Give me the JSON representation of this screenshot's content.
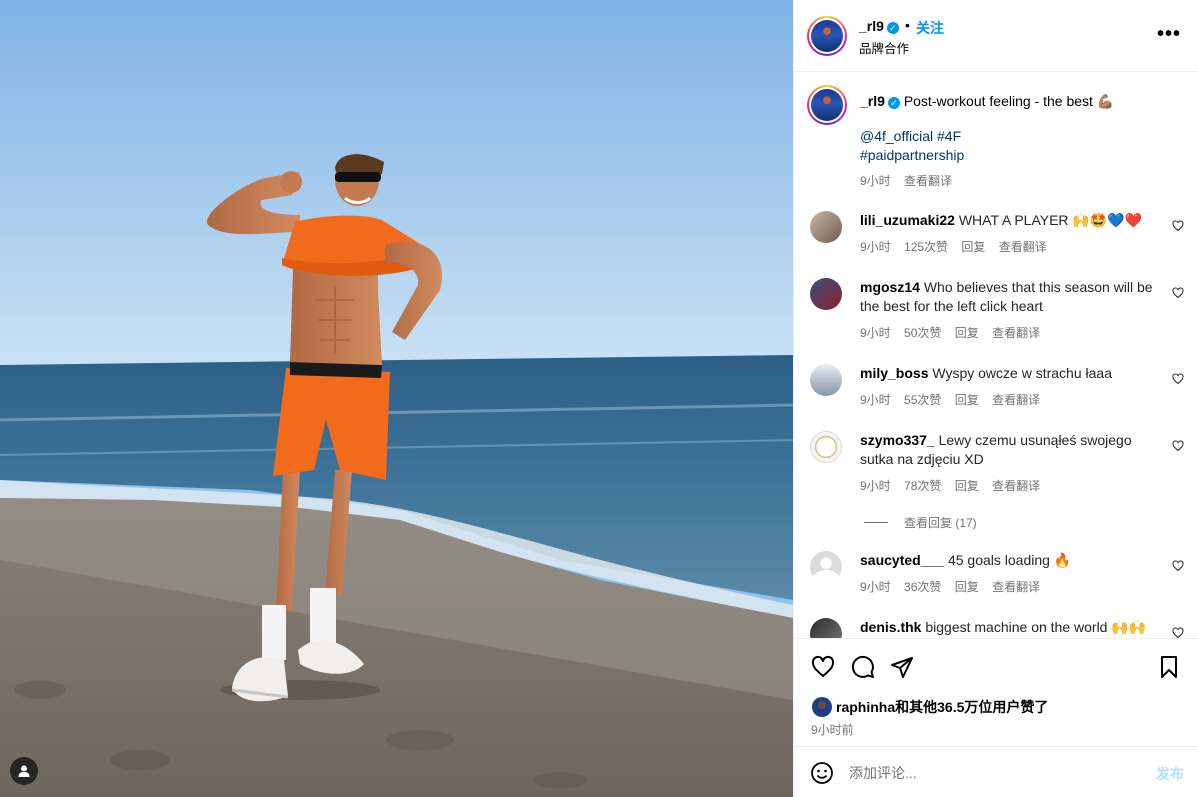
{
  "header": {
    "username": "_rl9",
    "verified_mark": "✓",
    "separator": "•",
    "follow_label": "关注",
    "subtitle": "品牌合作",
    "more_icon": "more-horizontal-icon"
  },
  "caption": {
    "username": "_rl9",
    "verified_mark": "✓",
    "text": "Post-workout feeling - the best 💪🏽",
    "mentions": "@4f_official #4F",
    "hashtags": "#paidpartnership",
    "time": "9小时",
    "translate": "查看翻译"
  },
  "comments": [
    {
      "username": "lili_uzumaki22",
      "text": "WHAT A PLAYER 🙌🤩💙❤️",
      "time": "9小时",
      "likes": "125次赞",
      "reply": "回复",
      "translate": "查看翻译"
    },
    {
      "username": "mgosz14",
      "text": "Who believes that this season will be the best for the left click heart",
      "time": "9小时",
      "likes": "50次赞",
      "reply": "回复",
      "translate": "查看翻译"
    },
    {
      "username": "mily_boss",
      "text": "Wyspy owcze w strachu łaaa",
      "time": "9小时",
      "likes": "55次赞",
      "reply": "回复",
      "translate": "查看翻译"
    },
    {
      "username": "szymo337_",
      "text": "Lewy czemu usunąłeś swojego sutka na zdjęciu XD",
      "time": "9小时",
      "likes": "78次赞",
      "reply": "回复",
      "translate": "查看翻译"
    },
    {
      "username": "saucyted___",
      "text": "45 goals loading 🔥",
      "time": "9小时",
      "likes": "36次赞",
      "reply": "回复",
      "translate": "查看翻译"
    },
    {
      "username": "denis.thk",
      "text": "biggest machine on the world 🙌🙌",
      "time": "",
      "likes": "",
      "reply": "",
      "translate": ""
    }
  ],
  "view_replies": "查看回复 (17)",
  "actions": {
    "like_icon": "heart-icon",
    "comment_icon": "comment-icon",
    "share_icon": "send-icon",
    "save_icon": "bookmark-icon",
    "likes_text": "raphinha和其他36.5万位用户赞了",
    "time_ago": "9小时前"
  },
  "composer": {
    "placeholder": "添加评论...",
    "post_label": "发布",
    "emoji_icon": "emoji-icon"
  },
  "colors": {
    "accent_blue": "#0095f6",
    "link_blue": "#00376b",
    "muted": "#737373",
    "post_disabled": "#b2dffc"
  }
}
